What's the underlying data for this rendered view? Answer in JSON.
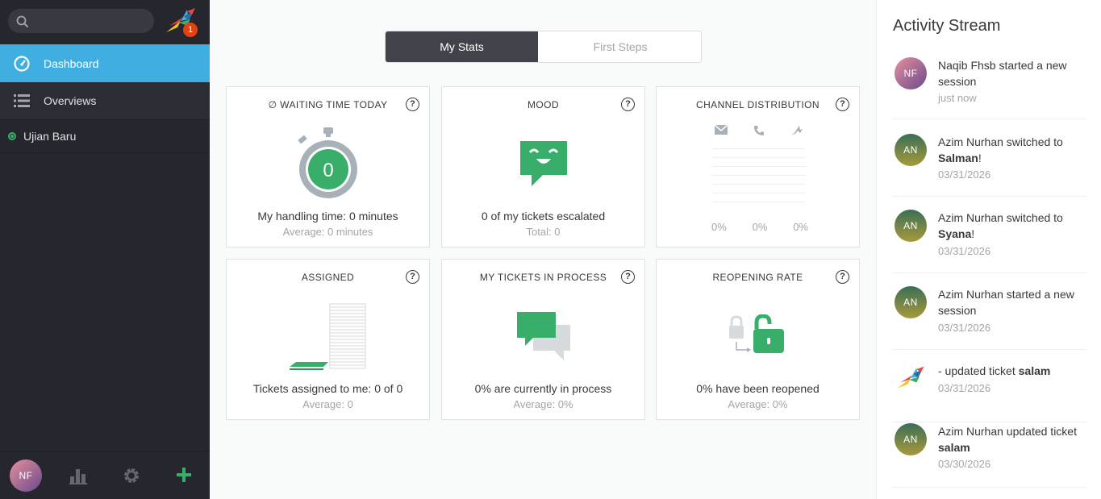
{
  "sidebar": {
    "search_placeholder": "",
    "notification_count": "1",
    "nav": [
      {
        "label": "Dashboard",
        "active": true
      },
      {
        "label": "Overviews",
        "active": false
      }
    ],
    "task_item": "Ujian Baru",
    "user_initials": "NF"
  },
  "tabs": [
    {
      "label": "My Stats",
      "active": true
    },
    {
      "label": "First Steps",
      "active": false
    }
  ],
  "cards": {
    "waiting": {
      "title": "∅ WAITING TIME TODAY",
      "value": "0",
      "main": "My handling time: 0 minutes",
      "sub": "Average: 0 minutes"
    },
    "mood": {
      "title": "MOOD",
      "main": "0 of my tickets escalated",
      "sub": "Total: 0"
    },
    "channel": {
      "title": "CHANNEL DISTRIBUTION",
      "pcts": [
        "0%",
        "0%",
        "0%"
      ]
    },
    "assigned": {
      "title": "ASSIGNED",
      "main": "Tickets assigned to me: 0 of 0",
      "sub": "Average: 0"
    },
    "in_process": {
      "title": "MY TICKETS IN PROCESS",
      "main": "0% are currently in process",
      "sub": "Average: 0%"
    },
    "reopening": {
      "title": "REOPENING RATE",
      "main": "0% have been reopened",
      "sub": "Average: 0%"
    }
  },
  "help_glyph": "?",
  "activity": {
    "title": "Activity Stream",
    "items": [
      {
        "initials": "NF",
        "text": "Naqib Fhsb started a new session",
        "bold": "",
        "suffix": "",
        "time": "just now"
      },
      {
        "initials": "AN",
        "text": "Azim Nurhan switched to ",
        "bold": "Salman",
        "suffix": "!",
        "time": "03/31/2026"
      },
      {
        "initials": "AN",
        "text": "Azim Nurhan switched to ",
        "bold": "Syana",
        "suffix": "!",
        "time": "03/31/2026"
      },
      {
        "initials": "AN",
        "text": "Azim Nurhan started a new session",
        "bold": "",
        "suffix": "",
        "time": "03/31/2026"
      },
      {
        "initials": "",
        "text": "- updated ticket ",
        "bold": "salam",
        "suffix": "",
        "time": "03/31/2026"
      },
      {
        "initials": "AN",
        "text": "Azim Nurhan updated ticket ",
        "bold": "salam",
        "suffix": "",
        "time": "03/30/2026"
      }
    ]
  },
  "colors": {
    "accent": "#41aee2",
    "sidebar": "#26272e",
    "green": "#38ae6a",
    "badge": "#e54011"
  }
}
